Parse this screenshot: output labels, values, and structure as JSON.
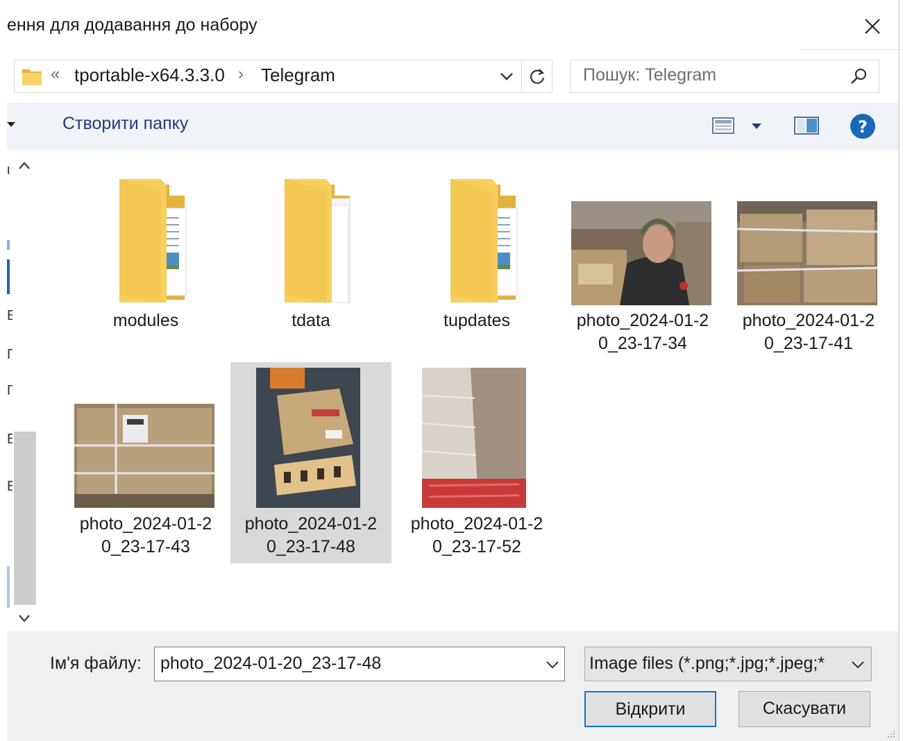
{
  "dialog": {
    "title": "ення для додавання до набору"
  },
  "address": {
    "overflow": "«",
    "crumbs": [
      "tportable-x64.3.3.0",
      "Telegram"
    ],
    "separator": "›"
  },
  "search": {
    "placeholder": "Пошук: Telegram"
  },
  "toolbar": {
    "new_folder": "Створити папку"
  },
  "sidebar": {
    "fragments": [
      "ι",
      "E",
      "Γ",
      "Γ",
      "E",
      "E"
    ]
  },
  "files": [
    {
      "label": "modules",
      "type": "folder"
    },
    {
      "label": "tdata",
      "type": "folder"
    },
    {
      "label": "tupdates",
      "type": "folder"
    },
    {
      "label_line1": "photo_2024-01-2",
      "label_line2": "0_23-17-34",
      "type": "image"
    },
    {
      "label_line1": "photo_2024-01-2",
      "label_line2": "0_23-17-41",
      "type": "image"
    },
    {
      "label_line1": "photo_2024-01-2",
      "label_line2": "0_23-17-43",
      "type": "image"
    },
    {
      "label_line1": "photo_2024-01-2",
      "label_line2": "0_23-17-48",
      "type": "image",
      "selected": true
    },
    {
      "label_line1": "photo_2024-01-2",
      "label_line2": "0_23-17-52",
      "type": "image"
    }
  ],
  "footer": {
    "filename_label": "Ім'я файлу:",
    "filename_value": "photo_2024-01-20_23-17-48",
    "filter": "Image files (*.png;*.jpg;*.jpeg;*",
    "open_button": "Відкрити",
    "cancel_button": "Скасувати"
  },
  "colors": {
    "accent": "#0078d7",
    "link": "#1e3c78",
    "folder": "#f7cf5c",
    "selection": "#d9d9d9",
    "help": "#1a68b8"
  }
}
